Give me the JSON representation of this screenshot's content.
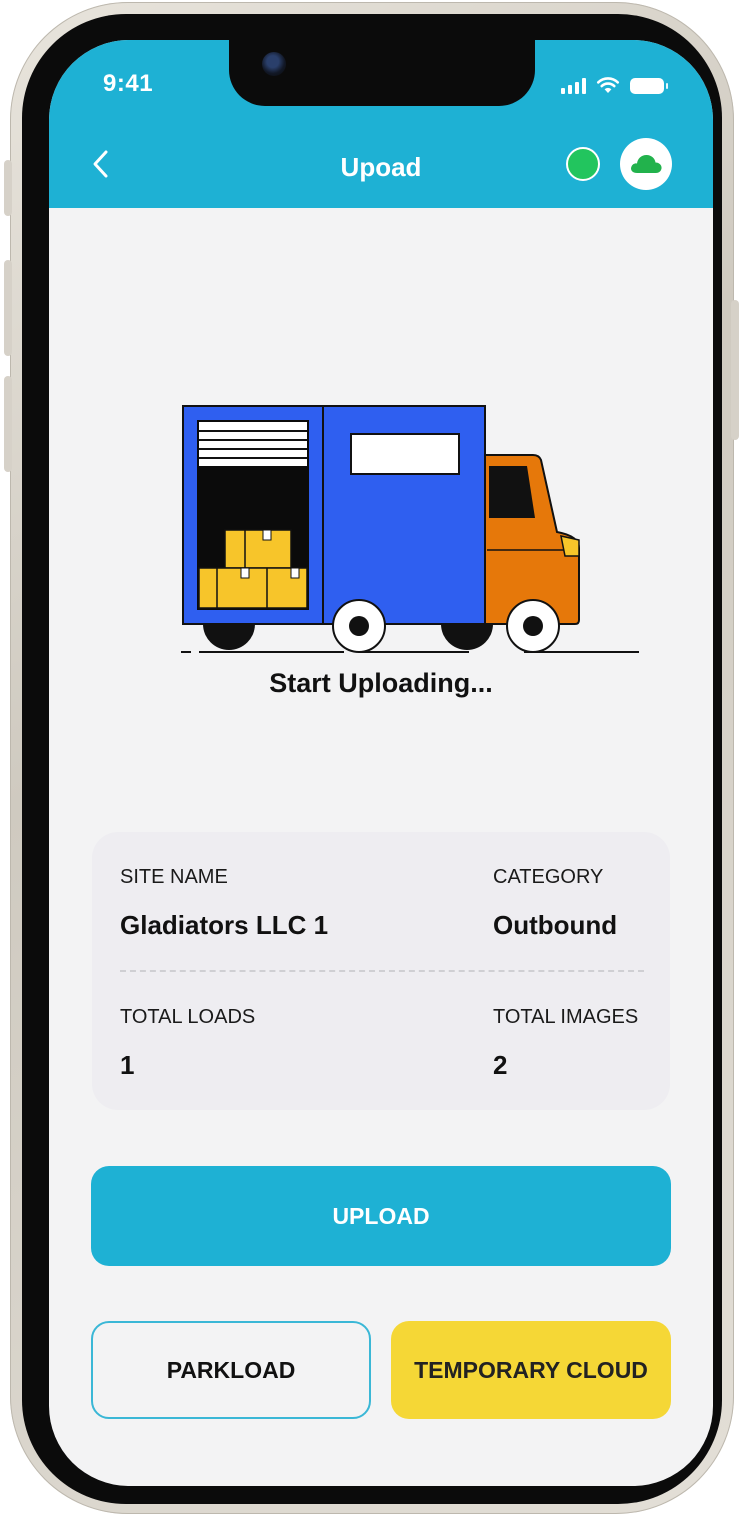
{
  "status_bar": {
    "time": "9:41",
    "icons": [
      "signal-icon",
      "wifi-icon",
      "battery-icon"
    ]
  },
  "header": {
    "title": "Upoad",
    "back_icon": "chevron-left-icon",
    "status_dot_color": "#22c55e",
    "cloud_icon": "cloud-icon"
  },
  "illustration": {
    "caption": "Start Uploading..."
  },
  "info": {
    "site_name_label": "SITE NAME",
    "site_name_value": "Gladiators LLC 1",
    "category_label": "CATEGORY",
    "category_value": "Outbound",
    "total_loads_label": "TOTAL LOADS",
    "total_loads_value": "1",
    "total_images_label": "TOTAL IMAGES",
    "total_images_value": "2"
  },
  "actions": {
    "upload": "UPLOAD",
    "parkload": "PARKLOAD",
    "temporary_cloud": "TEMPORARY CLOUD"
  },
  "colors": {
    "accent": "#1eb1d4",
    "secondary_button": "#f5d736",
    "truck_body": "#2f5ff0",
    "truck_cab": "#e6780a",
    "boxes": "#f7c52a"
  }
}
